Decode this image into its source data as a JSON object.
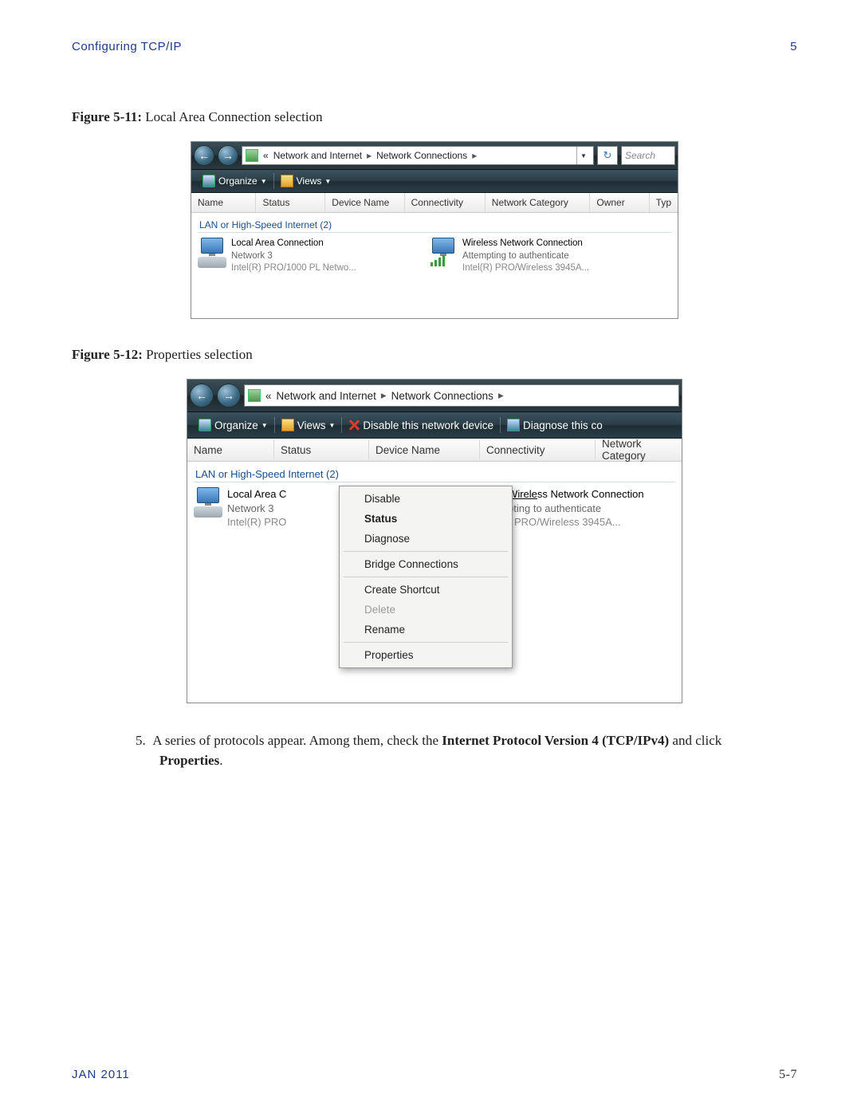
{
  "header": {
    "left": "Configuring TCP/IP",
    "right": "5"
  },
  "fig11": {
    "label": "Figure 5-11:",
    "caption": "Local Area Connection selection"
  },
  "fig12": {
    "label": "Figure 5-12:",
    "caption": "Properties selection"
  },
  "breadcrumb": {
    "a": "Network and Internet",
    "b": "Network Connections"
  },
  "search_placeholder": "Search",
  "toolbar": {
    "organize": "Organize",
    "views": "Views",
    "disable": "Disable this network device",
    "diagnose": "Diagnose this co"
  },
  "columns1": {
    "name": "Name",
    "status": "Status",
    "device": "Device Name",
    "conn": "Connectivity",
    "cat": "Network Category",
    "owner": "Owner",
    "typ": "Typ"
  },
  "columns2": {
    "name": "Name",
    "status": "Status",
    "device": "Device Name",
    "conn": "Connectivity",
    "cat": "Network Category"
  },
  "group": "LAN or High-Speed Internet (2)",
  "lan": {
    "l1": "Local Area Connection",
    "l2": "Network 3",
    "l3": "Intel(R) PRO/1000 PL Netwo..."
  },
  "wlan": {
    "l1": "Wireless Network Connection",
    "l2": "Attempting to authenticate",
    "l3": "Intel(R) PRO/Wireless 3945A..."
  },
  "lan2": {
    "l1": "Local Area C",
    "l2": "Network 3",
    "l3": "Intel(R) PRO"
  },
  "wlan2": {
    "l1": "ss Network Connection",
    "l1pre": "Wirele",
    "l2": "pting to authenticate",
    "l3": ") PRO/Wireless 3945A..."
  },
  "menu": {
    "disable": "Disable",
    "status": "Status",
    "diagnose": "Diagnose",
    "bridge": "Bridge Connections",
    "shortcut": "Create Shortcut",
    "delete": "Delete",
    "rename": "Rename",
    "properties": "Properties"
  },
  "step": {
    "num": "5.",
    "t1": "A series of protocols appear. Among them, check the ",
    "b1": "Internet Protocol Version 4 (TCP/IPv4)",
    "t2": " and click ",
    "b2": "Properties",
    "t3": "."
  },
  "footer": {
    "date": "JAN 2011",
    "page": "5-7"
  }
}
